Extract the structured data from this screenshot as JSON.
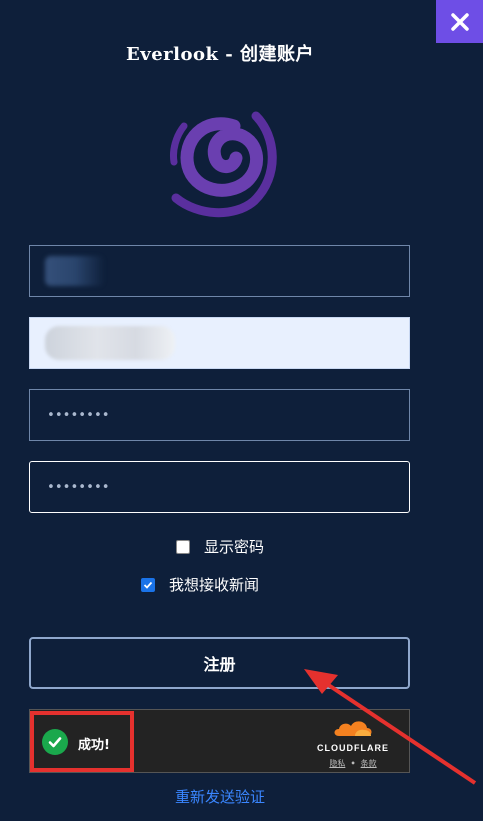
{
  "close_icon": "close-icon",
  "title": "Everlook - 创建账户",
  "logo_icon": "swirl-logo-icon",
  "fields": {
    "username": {
      "value": ""
    },
    "email": {
      "value": ""
    },
    "password": {
      "value": "••••••••"
    },
    "confirm_password": {
      "value": "••••••••"
    }
  },
  "show_password": {
    "label": "显示密码",
    "checked": false
  },
  "newsletter": {
    "label": "我想接收新闻",
    "checked": true
  },
  "register_button": "注册",
  "captcha": {
    "status": "成功!",
    "brand": "CLOUDFLARE",
    "privacy": "隐私",
    "separator": "•",
    "terms": "条款"
  },
  "resend_link": "重新发送验证",
  "colors": {
    "background": "#0e1f3a",
    "accent": "#6e4ee6",
    "logo": "#6a3fb0",
    "annotation": "#e5312e",
    "link": "#3a86ff"
  }
}
